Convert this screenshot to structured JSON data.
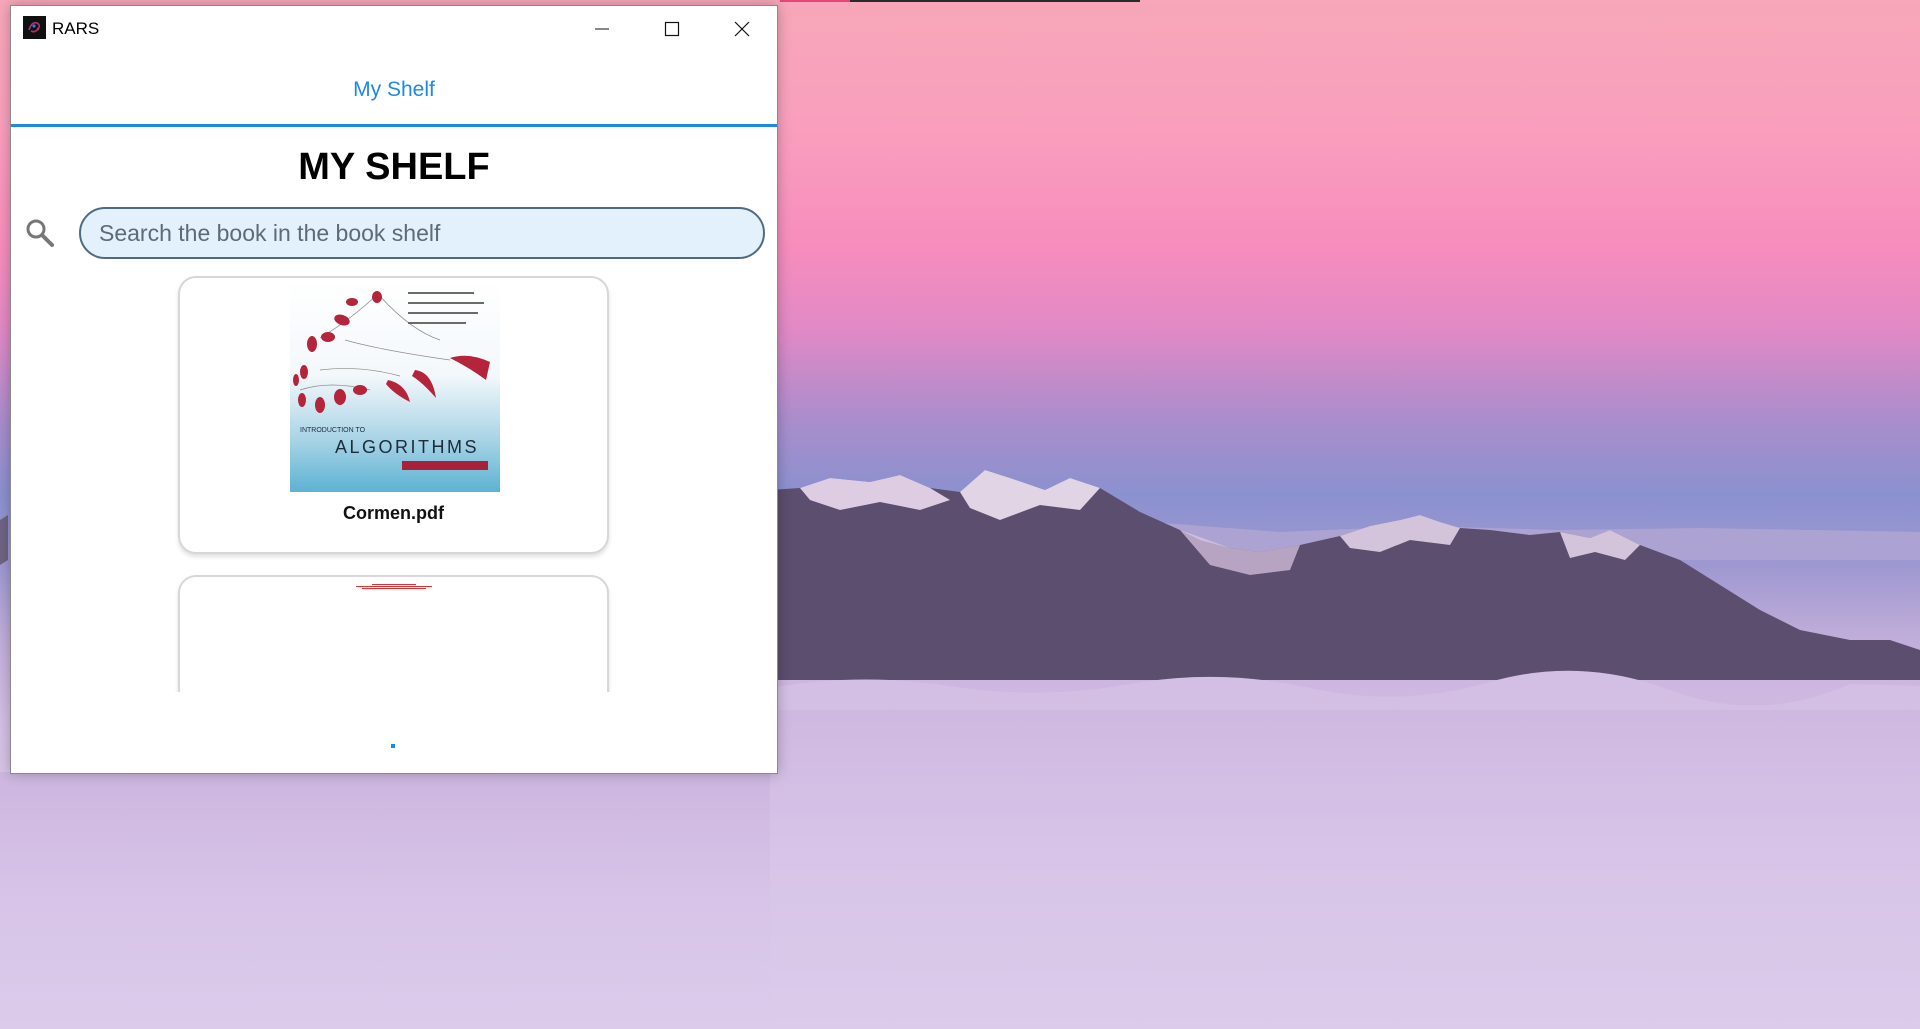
{
  "window": {
    "title": "RARS",
    "icons": {
      "app": "rars-app-icon",
      "minimize": "minimize-icon",
      "maximize": "maximize-icon",
      "close": "close-icon"
    }
  },
  "tabs": [
    {
      "label": "My Shelf",
      "active": true
    }
  ],
  "page": {
    "title": "MY SHELF"
  },
  "search": {
    "icon": "search-icon",
    "placeholder": "Search the book in the book shelf",
    "value": ""
  },
  "books": [
    {
      "file_name": "Cormen.pdf",
      "cover_title": "ALGORITHMS",
      "cover_prefix": "INTRODUCTION TO"
    },
    {
      "file_name": ""
    }
  ],
  "colors": {
    "accent": "#1e88e5",
    "search_bg": "#e3f1fc",
    "search_border": "#4f6b84"
  }
}
